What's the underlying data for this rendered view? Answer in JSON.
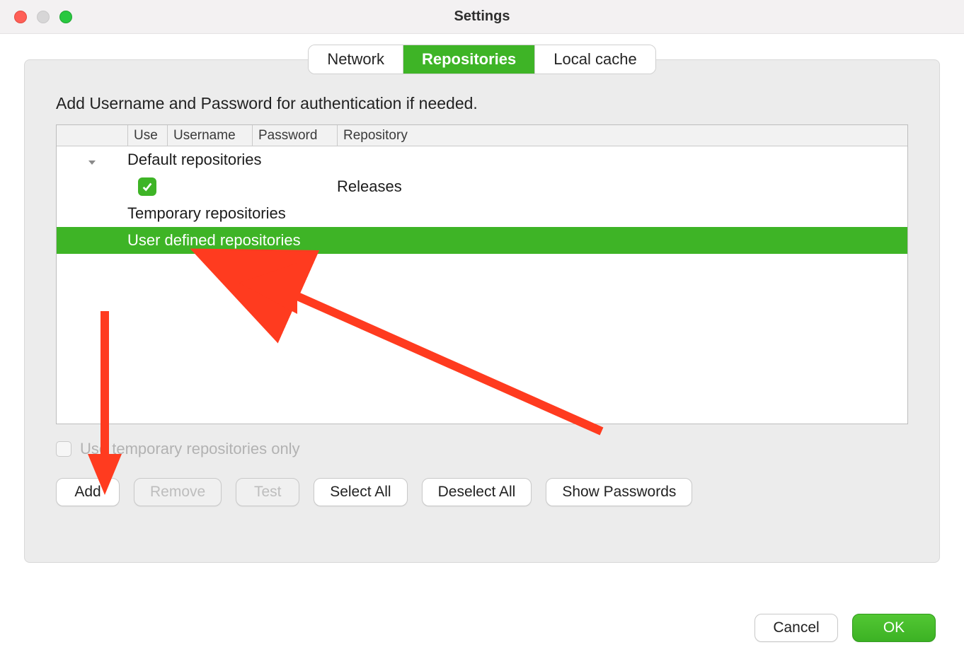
{
  "window": {
    "title": "Settings"
  },
  "tabs": {
    "network": "Network",
    "repositories": "Repositories",
    "local_cache": "Local cache"
  },
  "instruction": "Add Username and Password for authentication if needed.",
  "columns": {
    "use": "Use",
    "username": "Username",
    "password": "Password",
    "repository": "Repository"
  },
  "groups": {
    "default": "Default repositories",
    "temporary": "Temporary repositories",
    "user_defined": "User defined repositories"
  },
  "rows": {
    "releases": {
      "repository": "Releases",
      "use_checked": true
    }
  },
  "option": {
    "temp_only": "Use temporary repositories only"
  },
  "buttons": {
    "add": "Add",
    "remove": "Remove",
    "test": "Test",
    "select_all": "Select All",
    "deselect_all": "Deselect All",
    "show_passwords": "Show Passwords",
    "cancel": "Cancel",
    "ok": "OK"
  }
}
